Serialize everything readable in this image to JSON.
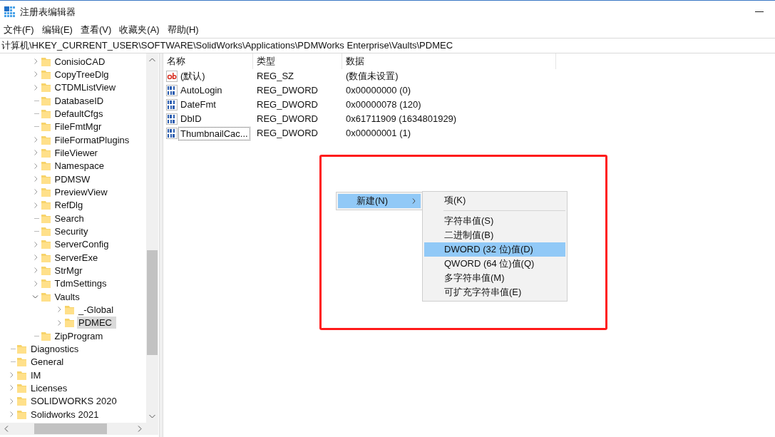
{
  "window": {
    "title": "注册表编辑器"
  },
  "menu_bar": [
    "文件(F)",
    "编辑(E)",
    "查看(V)",
    "收藏夹(A)",
    "帮助(H)"
  ],
  "address_bar": {
    "value": "计算机\\HKEY_CURRENT_USER\\SOFTWARE\\SolidWorks\\Applications\\PDMWorks Enterprise\\Vaults\\PDMEC"
  },
  "tree": {
    "scrolled_parent_children": [
      {
        "label": "ConisioCAD",
        "has_children": true,
        "expanded": false,
        "selected": false
      },
      {
        "label": "CopyTreeDlg",
        "has_children": true,
        "expanded": false,
        "selected": false
      },
      {
        "label": "CTDMListView",
        "has_children": true,
        "expanded": false,
        "selected": false
      },
      {
        "label": "DatabaseID",
        "has_children": false,
        "selected": false
      },
      {
        "label": "DefaultCfgs",
        "has_children": false,
        "selected": false
      },
      {
        "label": "FileFmtMgr",
        "has_children": false,
        "selected": false
      },
      {
        "label": "FileFormatPlugins",
        "has_children": true,
        "expanded": false,
        "selected": false
      },
      {
        "label": "FileViewer",
        "has_children": true,
        "expanded": false,
        "selected": false
      },
      {
        "label": "Namespace",
        "has_children": true,
        "expanded": false,
        "selected": false
      },
      {
        "label": "PDMSW",
        "has_children": true,
        "expanded": false,
        "selected": false
      },
      {
        "label": "PreviewView",
        "has_children": true,
        "expanded": false,
        "selected": false
      },
      {
        "label": "RefDlg",
        "has_children": true,
        "expanded": false,
        "selected": false
      },
      {
        "label": "Search",
        "has_children": false,
        "selected": false
      },
      {
        "label": "Security",
        "has_children": false,
        "selected": false
      },
      {
        "label": "ServerConfig",
        "has_children": true,
        "expanded": false,
        "selected": false
      },
      {
        "label": "ServerExe",
        "has_children": true,
        "expanded": false,
        "selected": false
      },
      {
        "label": "StrMgr",
        "has_children": true,
        "expanded": false,
        "selected": false
      },
      {
        "label": "TdmSettings",
        "has_children": true,
        "expanded": false,
        "selected": false
      },
      {
        "label": "Vaults",
        "has_children": true,
        "expanded": true,
        "selected": false,
        "children": [
          {
            "label": "_-Global",
            "has_children": true,
            "expanded": false,
            "selected": false
          },
          {
            "label": "PDMEC",
            "has_children": true,
            "expanded": false,
            "selected": true
          }
        ]
      },
      {
        "label": "ZipProgram",
        "has_children": false,
        "selected": false
      }
    ],
    "items": [
      {
        "label": "Diagnostics",
        "has_children": false,
        "selected": false
      },
      {
        "label": "General",
        "has_children": false,
        "selected": false
      },
      {
        "label": "IM",
        "has_children": true,
        "expanded": false,
        "selected": false
      },
      {
        "label": "Licenses",
        "has_children": true,
        "expanded": false,
        "selected": false
      },
      {
        "label": "SOLIDWORKS 2020",
        "has_children": true,
        "expanded": false,
        "selected": false
      },
      {
        "label": "Solidworks 2021",
        "has_children": true,
        "expanded": false,
        "selected": false
      }
    ]
  },
  "values_table": {
    "columns": [
      "名称",
      "类型",
      "数据"
    ],
    "rows": [
      {
        "kind": "string",
        "name": "(默认)",
        "type": "REG_SZ",
        "data": "(数值未设置)",
        "focused": false
      },
      {
        "kind": "dword",
        "name": "AutoLogin",
        "type": "REG_DWORD",
        "data": "0x00000000 (0)",
        "focused": false
      },
      {
        "kind": "dword",
        "name": "DateFmt",
        "type": "REG_DWORD",
        "data": "0x00000078 (120)",
        "focused": false
      },
      {
        "kind": "dword",
        "name": "DbID",
        "type": "REG_DWORD",
        "data": "0x61711909 (1634801929)",
        "focused": false
      },
      {
        "kind": "dword",
        "name": "ThumbnailCac...",
        "type": "REG_DWORD",
        "data": "0x00000001 (1)",
        "focused": true
      }
    ]
  },
  "context_menu": {
    "items": [
      {
        "label": "新建(N)",
        "selected": true,
        "has_submenu": true
      }
    ]
  },
  "submenu": {
    "items": [
      {
        "kind": "item",
        "label": "项(K)",
        "selected": false
      },
      {
        "kind": "separator"
      },
      {
        "kind": "item",
        "label": "字符串值(S)",
        "selected": false
      },
      {
        "kind": "item",
        "label": "二进制值(B)",
        "selected": false
      },
      {
        "kind": "item",
        "label": "DWORD (32 位)值(D)",
        "selected": true
      },
      {
        "kind": "item",
        "label": "QWORD (64 位)值(Q)",
        "selected": false
      },
      {
        "kind": "item",
        "label": "多字符串值(M)",
        "selected": false
      },
      {
        "kind": "item",
        "label": "可扩充字符串值(E)",
        "selected": false
      }
    ]
  }
}
